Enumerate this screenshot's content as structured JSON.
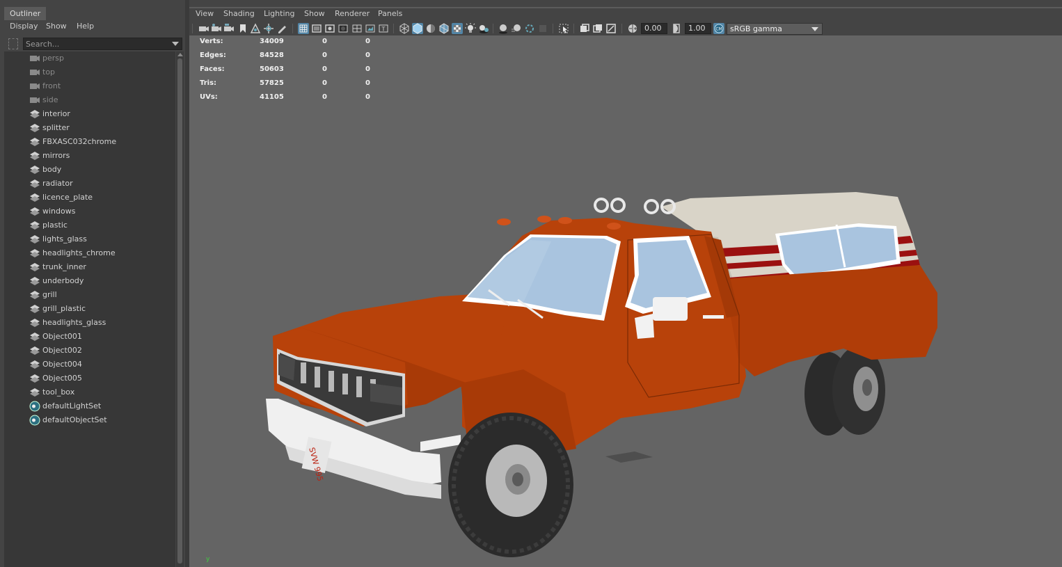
{
  "outliner": {
    "title": "Outliner",
    "menu": [
      "Display",
      "Show",
      "Help"
    ],
    "search_placeholder": "Search...",
    "items": [
      {
        "label": "persp",
        "icon": "camera-icon"
      },
      {
        "label": "top",
        "icon": "camera-icon"
      },
      {
        "label": "front",
        "icon": "camera-icon"
      },
      {
        "label": "side",
        "icon": "camera-icon"
      },
      {
        "label": "interior",
        "icon": "mesh-node-icon"
      },
      {
        "label": "splitter",
        "icon": "mesh-node-icon"
      },
      {
        "label": "FBXASC032chrome",
        "icon": "mesh-node-icon"
      },
      {
        "label": "mirrors",
        "icon": "mesh-node-icon"
      },
      {
        "label": "body",
        "icon": "mesh-node-icon"
      },
      {
        "label": "radiator",
        "icon": "mesh-node-icon"
      },
      {
        "label": "licence_plate",
        "icon": "mesh-node-icon"
      },
      {
        "label": "windows",
        "icon": "mesh-node-icon"
      },
      {
        "label": "plastic",
        "icon": "mesh-node-icon"
      },
      {
        "label": "lights_glass",
        "icon": "mesh-node-icon"
      },
      {
        "label": "headlights_chrome",
        "icon": "mesh-node-icon"
      },
      {
        "label": "trunk_inner",
        "icon": "mesh-node-icon"
      },
      {
        "label": "underbody",
        "icon": "mesh-node-icon"
      },
      {
        "label": "grill",
        "icon": "mesh-node-icon"
      },
      {
        "label": "grill_plastic",
        "icon": "mesh-node-icon"
      },
      {
        "label": "headlights_glass",
        "icon": "mesh-node-icon"
      },
      {
        "label": "Object001",
        "icon": "mesh-node-icon"
      },
      {
        "label": "Object002",
        "icon": "mesh-node-icon"
      },
      {
        "label": "Object004",
        "icon": "mesh-node-icon"
      },
      {
        "label": "Object005",
        "icon": "mesh-node-icon"
      },
      {
        "label": "tool_box",
        "icon": "mesh-node-icon"
      },
      {
        "label": "defaultLightSet",
        "icon": "set-icon"
      },
      {
        "label": "defaultObjectSet",
        "icon": "set-icon"
      }
    ]
  },
  "viewport": {
    "menu": [
      "View",
      "Shading",
      "Lighting",
      "Show",
      "Renderer",
      "Panels"
    ],
    "toolbar": {
      "exposure_value": "0.00",
      "gamma_value": "1.00",
      "color_space": "sRGB gamma"
    },
    "hud": [
      {
        "label": "Verts:",
        "values": [
          "34009",
          "0",
          "0"
        ]
      },
      {
        "label": "Edges:",
        "values": [
          "84528",
          "0",
          "0"
        ]
      },
      {
        "label": "Faces:",
        "values": [
          "50603",
          "0",
          "0"
        ]
      },
      {
        "label": "Tris:",
        "values": [
          "57825",
          "0",
          "0"
        ]
      },
      {
        "label": "UVs:",
        "values": [
          "41105",
          "0",
          "0"
        ]
      }
    ],
    "axis_label": "y",
    "license_plate_text": "SVW 995"
  },
  "colors": {
    "body_orange": "#b8420a",
    "camper_shell": "#d9d4c8",
    "stripe_red": "#9b1010",
    "glass": "#a9c4df",
    "tire": "#2e2e2e",
    "rim": "#b9b9b9",
    "viewport_bg": "#646464",
    "accent_blue": "#5285a6"
  }
}
